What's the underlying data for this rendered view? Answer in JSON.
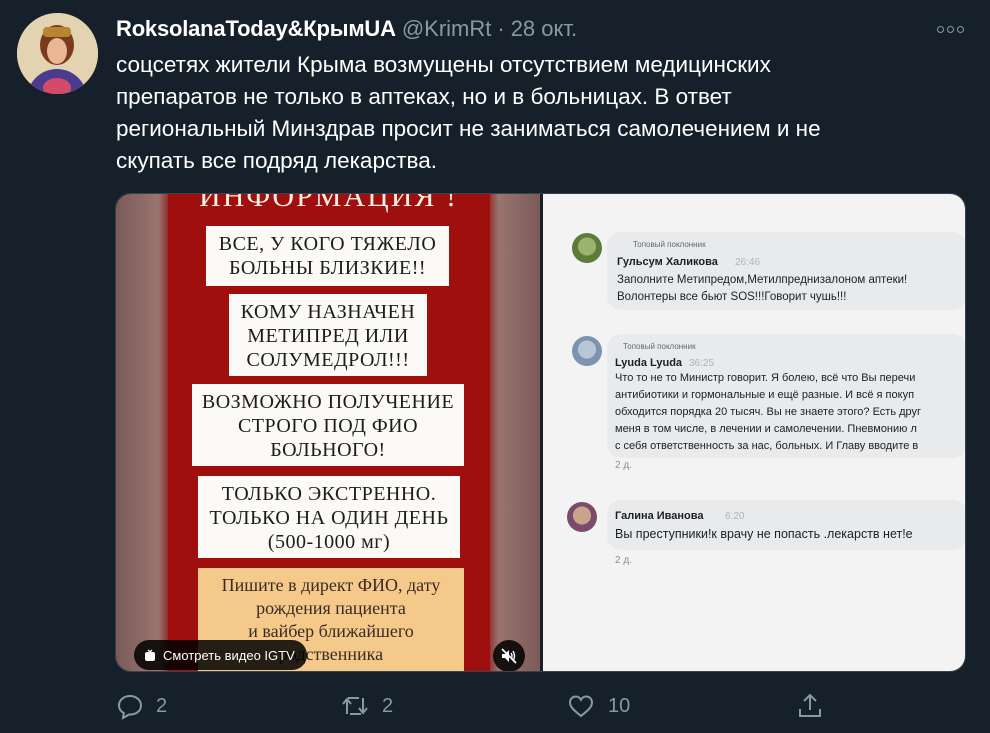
{
  "tweet": {
    "author_name": "RoksolanaToday&КрымUA",
    "handle": "@KrimRt",
    "separator": "·",
    "date": "28 окт.",
    "text_lines": [
      "соцсетях жители Крыма возмущены отсутствием медицинских",
      "препаратов не только в аптеках, но и в больницах. В ответ",
      "региональный Минздрав просит не заниматься самолечением и не",
      "скупать все подряд лекарства."
    ]
  },
  "media": {
    "left": {
      "heading": "ИНФОРМАЦИЯ !",
      "cards": [
        [
          "ВСЕ, У КОГО ТЯЖЕЛО",
          "БОЛЬНЫ БЛИЗКИЕ!!"
        ],
        [
          "КОМУ НАЗНАЧЕН",
          "МЕТИПРЕД ИЛИ",
          "СОЛУМЕДРОЛ!!!"
        ],
        [
          "ВОЗМОЖНО ПОЛУЧЕНИЕ",
          "СТРОГО ПОД ФИО",
          "БОЛЬНОГО!"
        ],
        [
          "ТОЛЬКО ЭКСТРЕННО.",
          "ТОЛЬКО НА ОДИН ДЕНЬ",
          "(500-1000 мг)"
        ],
        [
          "Пишите в директ ФИО, дату",
          "рождения пациента",
          "и вайбер ближайшего",
          "родственника"
        ]
      ],
      "igtv_label": "Смотреть видео IGTV"
    },
    "right": {
      "comments": [
        {
          "badge": "Топовый поклонник",
          "name": "Гульсум Халикова",
          "time": "26:46",
          "text": "Заполните Метипредом,Метилпреднизалоном аптеки!\nВолонтеры все бьют SOS!!!Говорит чушь!!!",
          "meta": ""
        },
        {
          "badge": "Топовый поклонник",
          "name": "Lyuda Lyuda",
          "time": "36:25",
          "text": "Что то не то Министр говорит. Я болею, всё что Вы перечи\nантибиотики и гормональные и ещё разные. И всё я покуп\nобходится порядка 20 тысяч. Вы не знаете этого? Есть друг\nменя в том числе, в лечении и самолечении. Пневмонию л\nс себя ответственность за нас, больных. И Главу вводите в",
          "meta": "2 д."
        },
        {
          "badge": "",
          "name": "Галина Иванова",
          "time": "6:20",
          "text": "Вы преступники!к врачу не попасть .лекарств нет!е",
          "meta": "2 д."
        }
      ]
    }
  },
  "actions": {
    "replies": "2",
    "retweets": "2",
    "likes": "10"
  },
  "colors": {
    "background": "#15202b",
    "secondary_text": "#8899a6",
    "poster_red": "#a0110f",
    "card_orange": "#f4c98a"
  }
}
